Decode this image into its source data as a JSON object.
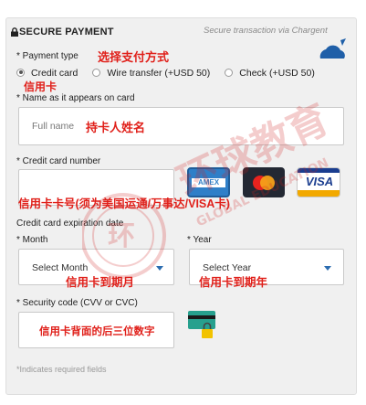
{
  "header": {
    "title": "SECURE PAYMENT",
    "secure_note": "Secure transaction via Chargent"
  },
  "payment_type": {
    "label": "* Payment type",
    "annotation": "选择支付方式",
    "options": [
      {
        "label": "Credit card",
        "selected": true
      },
      {
        "label": "Wire transfer (+USD 50)",
        "selected": false
      },
      {
        "label": "Check (+USD 50)",
        "selected": false
      }
    ],
    "selected_annotation": "信用卡"
  },
  "name_on_card": {
    "label": "* Name as it appears on card",
    "placeholder": "Full name",
    "annotation": "持卡人姓名"
  },
  "card_number": {
    "label": "* Credit card number",
    "annotation": "信用卡卡号(须为美国运通/万事达/VISA卡)",
    "brands": [
      {
        "name": "AMEX",
        "icon": "amex-icon"
      },
      {
        "name": "Mastercard",
        "icon": "mastercard-icon"
      },
      {
        "name": "VISA",
        "icon": "visa-icon"
      }
    ]
  },
  "expiration": {
    "label": "Credit card expiration date",
    "month": {
      "label": "* Month",
      "value": "Select Month",
      "annotation": "信用卡到期月"
    },
    "year": {
      "label": "* Year",
      "value": "Select Year",
      "annotation": "信用卡到期年"
    }
  },
  "security_code": {
    "label": "* Security code (CVV or CVC)",
    "annotation": "信用卡背面的后三位数字",
    "icon": "card-lock-icon"
  },
  "footer": {
    "note": "*Indicates required fields"
  },
  "watermark": {
    "text": "环球教育",
    "sub": "GLOBAL EDUCATION"
  },
  "colors": {
    "accent": "#2b6cb0",
    "annotation": "#e0201a",
    "panel": "#f0f0f0"
  }
}
